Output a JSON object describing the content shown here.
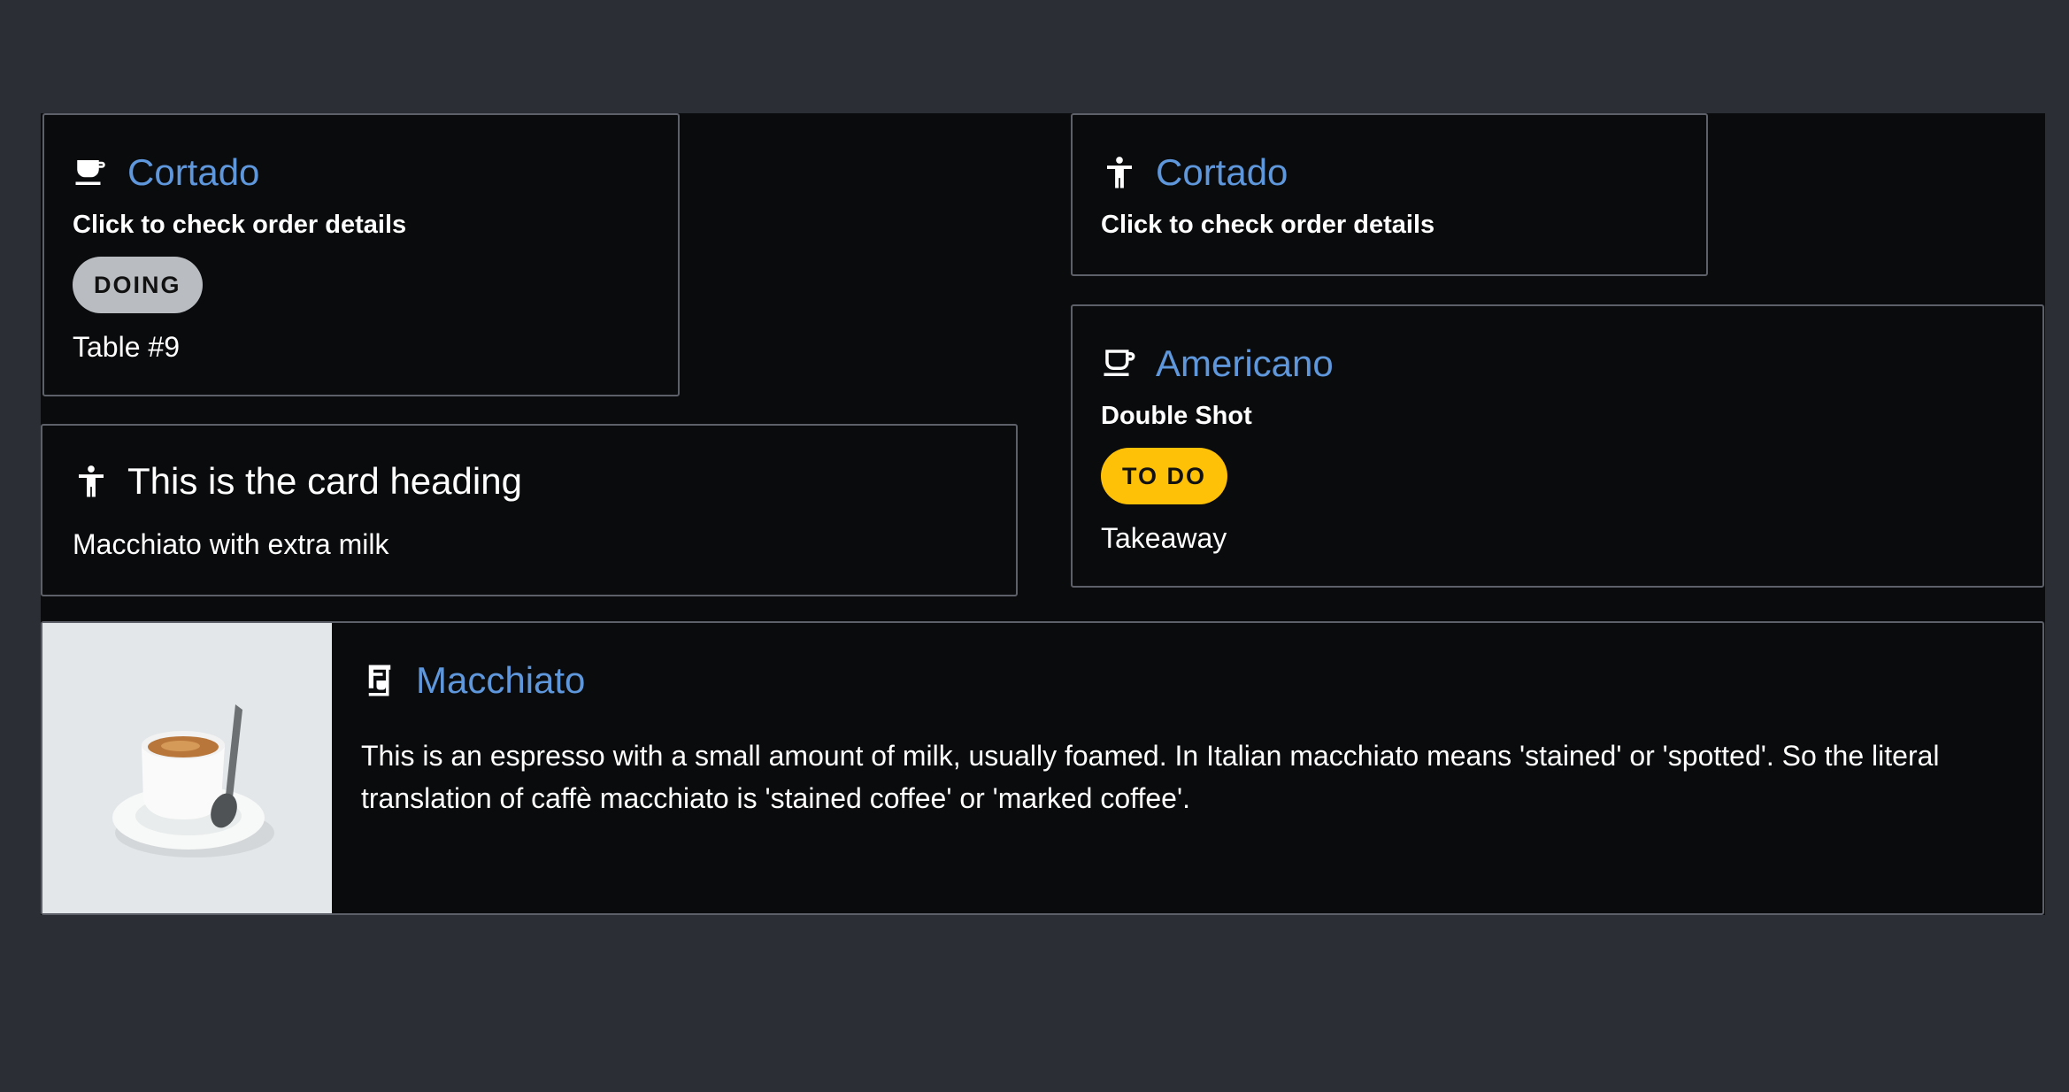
{
  "cards": [
    {
      "icon": "coffee-cup-icon",
      "title": "Cortado",
      "subtitle": "Click to check order details",
      "badge": "DOING",
      "badge_color": "#b9bcc1",
      "footer": "Table #9"
    },
    {
      "icon": "accessibility-icon",
      "title": "This is the card heading",
      "body": "Macchiato with extra milk"
    },
    {
      "icon": "accessibility-icon",
      "title": "Cortado",
      "subtitle": "Click to check order details"
    },
    {
      "icon": "mug-icon",
      "title": "Americano",
      "subtitle": "Double Shot",
      "badge": "TO DO",
      "badge_color": "#ffc107",
      "footer": "Takeaway"
    },
    {
      "icon": "coffee-machine-icon",
      "image": "espresso-cup-image",
      "title": "Macchiato",
      "body": "This is an espresso with a small amount of milk, usually foamed. In Italian macchiato means 'stained' or 'spotted'. So the literal translation of caffè macchiato is 'stained coffee' or 'marked coffee'."
    }
  ],
  "colors": {
    "page_background": "#2b2e35",
    "board_background": "#0a0b0c",
    "card_border": "#5d6068",
    "link_title": "#5f97dc"
  }
}
